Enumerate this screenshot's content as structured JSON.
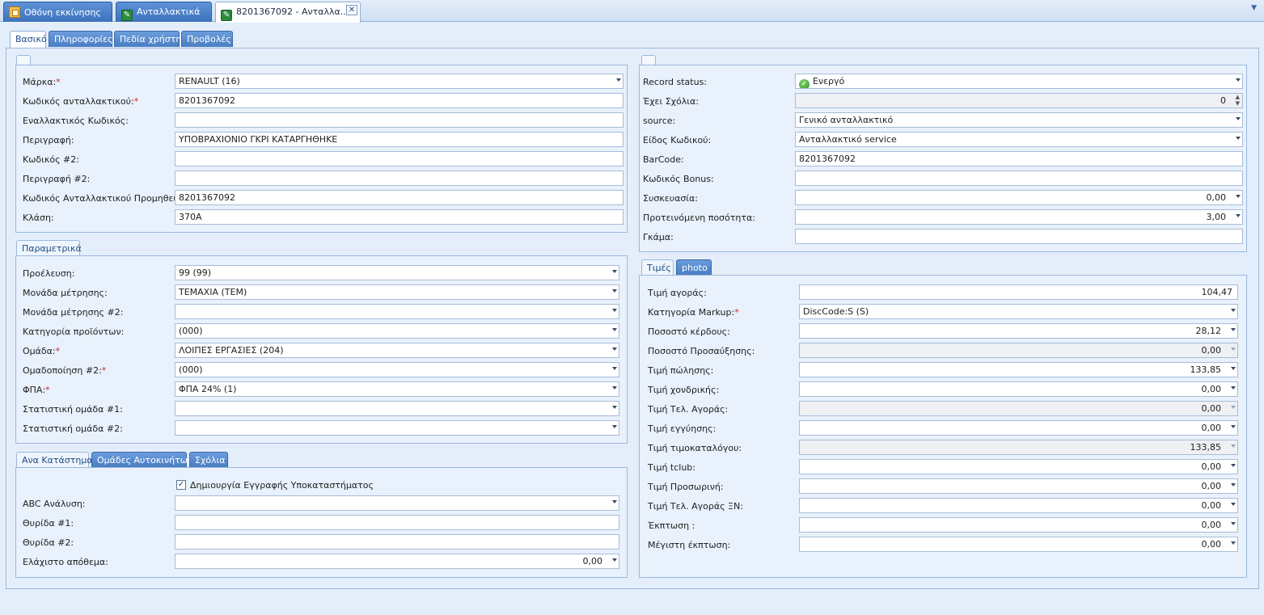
{
  "doc_tabs": [
    {
      "label": "Οθόνη εκκίνησης",
      "icon": "home-grid-icon"
    },
    {
      "label": "Ανταλλακτικά",
      "icon": "wrench-icon"
    },
    {
      "label": "8201367092 - Ανταλλα...",
      "icon": "wrench-icon"
    }
  ],
  "form_tabs": [
    "Βασικό",
    "Πληροφορίες",
    "Πεδία χρήστη",
    "Προβολές"
  ],
  "basic": {
    "brand_label": "Μάρκα:",
    "brand": "RENAULT (16)",
    "code_label": "Κωδικός ανταλλακτικού:",
    "code": "8201367092",
    "alt_code_label": "Εναλλακτικός Κωδικός:",
    "alt_code": "",
    "desc_label": "Περιγραφή:",
    "desc": "ΥΠΟΒΡΑΧΙΟΝΙΟ ΓΚΡΙ ΚΑΤΑΡΓΗΘΗΚΕ",
    "code2_label": "Κωδικός #2:",
    "code2": "",
    "desc2_label": "Περιγραφή #2:",
    "desc2": "",
    "supplier_code_label": "Κωδικός Ανταλλακτικού Προμηθευτή:",
    "supplier_code": "8201367092",
    "class_label": "Κλάση:",
    "class": "370A"
  },
  "params": {
    "tab": "Παραμετρικά",
    "origin_label": "Προέλευση:",
    "origin": "99 (99)",
    "unit_label": "Μονάδα μέτρησης:",
    "unit": "ΤΕΜΑΧΙΑ (ΤΕΜ)",
    "unit2_label": "Μονάδα μέτρησης #2:",
    "unit2": "",
    "category_label": "Κατηγορία προϊόντων:",
    "category": " (000)",
    "group_label": "Ομάδα:",
    "group": "ΛΟΙΠΕΣ ΕΡΓΑΣΙΕΣ (204)",
    "grouping2_label": "Ομαδοποίηση #2:",
    "grouping2": " (000)",
    "vat_label": "ΦΠΑ:",
    "vat": "ΦΠΑ 24%  (1)",
    "stat1_label": "Στατιστική ομάδα #1:",
    "stat1": "",
    "stat2_label": "Στατιστική ομάδα #2:",
    "stat2": ""
  },
  "store": {
    "tabs": [
      "Ανα Κατάστημα",
      "Ομάδες Αυτοκινήτων",
      "Σχόλια"
    ],
    "create_branch_label": "Δημιουργία Εγγραφής Υποκαταστήματος",
    "create_branch_checked": true,
    "abc_label": "ABC Ανάλυση:",
    "abc": "",
    "slot1_label": "Θυρίδα #1:",
    "slot1": "",
    "slot2_label": "Θυρίδα #2:",
    "slot2": "",
    "min_stock_label": "Ελάχιστο απόθεμα:",
    "min_stock": "0,00"
  },
  "record": {
    "status_label": "Record status:",
    "status": "Ενεργό",
    "comments_label": "Έχει Σχόλια:",
    "comments": "0",
    "source_label": "source:",
    "source": "Γενικό ανταλλακτικό",
    "code_type_label": "Είδος Κωδικού:",
    "code_type": "Ανταλλακτικό service",
    "barcode_label": "BarCode:",
    "barcode": "8201367092",
    "bonus_label": "Κωδικός Bonus:",
    "bonus": "",
    "packaging_label": "Συσκευασία:",
    "packaging": "0,00",
    "suggested_qty_label": "Προτεινόμενη ποσότητα:",
    "suggested_qty": "3,00",
    "range_label": "Γκάμα:",
    "range": ""
  },
  "prices": {
    "tabs": [
      "Τιμές",
      "photo"
    ],
    "rows": [
      {
        "label": "Τιμή αγοράς:",
        "value": "104,47",
        "type": "plain",
        "req": false
      },
      {
        "label": "Κατηγορία Markup:",
        "value": "DiscCode:S (S)",
        "type": "combo",
        "req": true
      },
      {
        "label": "Ποσοστό κέρδους:",
        "value": "28,12",
        "type": "num",
        "req": false
      },
      {
        "label": "Ποσοστό Προσαύξησης:",
        "value": "0,00",
        "type": "ro",
        "req": false
      },
      {
        "label": "Τιμή πώλησης:",
        "value": "133,85",
        "type": "num",
        "req": false
      },
      {
        "label": "Τιμή χονδρικής:",
        "value": "0,00",
        "type": "num",
        "req": false
      },
      {
        "label": "Τιμή Τελ. Αγοράς:",
        "value": "0,00",
        "type": "ro",
        "req": false
      },
      {
        "label": "Τιμή εγγύησης:",
        "value": "0,00",
        "type": "num",
        "req": false
      },
      {
        "label": "Τιμή τιμοκαταλόγου:",
        "value": "133,85",
        "type": "ro",
        "req": false
      },
      {
        "label": "Τιμή tclub:",
        "value": "0,00",
        "type": "num",
        "req": false
      },
      {
        "label": "Τιμή Προσωρινή:",
        "value": "0,00",
        "type": "num",
        "req": false
      },
      {
        "label": "Τιμή Τελ. Αγοράς ΞΝ:",
        "value": "0,00",
        "type": "num",
        "req": false
      },
      {
        "label": "Έκπτωση :",
        "value": "0,00",
        "type": "num",
        "req": false
      },
      {
        "label": "Μέγιστη έκπτωση:",
        "value": "0,00",
        "type": "num",
        "req": false
      }
    ]
  },
  "colors": {
    "required": "#d0242a",
    "tab_blue": "#4a7ec3",
    "status_green": "#2d8f2a"
  }
}
